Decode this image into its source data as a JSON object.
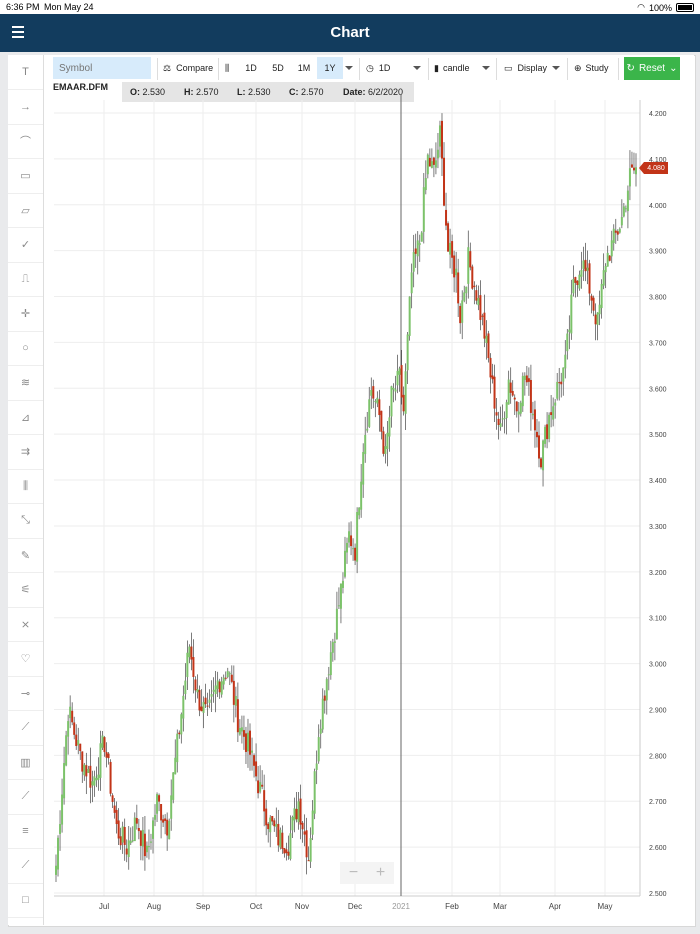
{
  "status": {
    "time": "6:36 PM",
    "date": "Mon May 24",
    "battery": "100%"
  },
  "header": {
    "title": "Chart",
    "menu_icon": "hamburger-icon"
  },
  "toolbar": {
    "symbol_placeholder": "Symbol",
    "compare": "Compare",
    "ranges": [
      "1D",
      "5D",
      "1M",
      "1Y"
    ],
    "active_range": "1Y",
    "interval": "1D",
    "chart_type": "candle",
    "display": "Display",
    "study": "Study",
    "reset": "Reset",
    "accent": "#3bb54a"
  },
  "drawing_tools": [
    "text-icon",
    "arrow-icon",
    "arc-icon",
    "callout-icon",
    "parallelogram-icon",
    "check-icon",
    "step-icon",
    "crosshair-icon",
    "ellipse-icon",
    "fan-icon",
    "gann-icon",
    "channel-icon",
    "pitchfork-icon",
    "scatter-icon",
    "note-icon",
    "speedline-icon",
    "xabcd-icon",
    "heart-icon",
    "horizontal-line-icon",
    "trendline-icon",
    "volume-profile-icon",
    "ruler-icon",
    "fibonacci-icon",
    "line-icon",
    "rectangle-icon"
  ],
  "info": {
    "symbol": "EMAAR.DFM",
    "open_label": "O:",
    "open": "2.530",
    "high_label": "H:",
    "high": "2.570",
    "low_label": "L:",
    "low": "2.530",
    "close_label": "C:",
    "close": "2.570",
    "date_label": "Date:",
    "date": "6/2/2020"
  },
  "last_price": "4.080",
  "colors": {
    "up": "#7cc26a",
    "down": "#c23418",
    "grid": "#eeeeee",
    "navbar": "#123c5e"
  },
  "chart_data": {
    "type": "candlestick",
    "symbol": "EMAAR.DFM",
    "y_ticks": [
      "2.500",
      "2.600",
      "2.700",
      "2.800",
      "2.900",
      "3.000",
      "3.100",
      "3.200",
      "3.300",
      "3.400",
      "3.500",
      "3.600",
      "3.700",
      "3.800",
      "3.900",
      "4.000",
      "4.100",
      "4.200"
    ],
    "ylim": [
      2.5,
      4.2
    ],
    "x_ticks": [
      "Jul",
      "Aug",
      "Sep",
      "Oct",
      "Nov",
      "Dec",
      "2021",
      "Feb",
      "Mar",
      "Apr",
      "May"
    ],
    "grid": true,
    "crosshair_at": "2021",
    "anchors": [
      [
        0,
        2.56
      ],
      [
        6,
        2.9
      ],
      [
        12,
        2.8
      ],
      [
        18,
        2.74
      ],
      [
        24,
        2.83
      ],
      [
        30,
        2.64
      ],
      [
        35,
        2.6
      ],
      [
        40,
        2.66
      ],
      [
        45,
        2.58
      ],
      [
        50,
        2.7
      ],
      [
        55,
        2.65
      ],
      [
        60,
        2.82
      ],
      [
        66,
        3.04
      ],
      [
        70,
        2.93
      ],
      [
        75,
        2.88
      ],
      [
        80,
        2.96
      ],
      [
        85,
        2.99
      ],
      [
        90,
        2.88
      ],
      [
        95,
        2.82
      ],
      [
        100,
        2.74
      ],
      [
        105,
        2.66
      ],
      [
        110,
        2.62
      ],
      [
        115,
        2.61
      ],
      [
        120,
        2.7
      ],
      [
        125,
        2.58
      ],
      [
        130,
        2.86
      ],
      [
        135,
        3.0
      ],
      [
        140,
        3.13
      ],
      [
        145,
        3.28
      ],
      [
        148,
        3.25
      ],
      [
        152,
        3.48
      ],
      [
        156,
        3.6
      ],
      [
        160,
        3.54
      ],
      [
        163,
        3.45
      ],
      [
        166,
        3.58
      ],
      [
        170,
        3.62
      ],
      [
        172,
        3.55
      ],
      [
        176,
        3.85
      ],
      [
        180,
        3.92
      ],
      [
        184,
        4.1
      ],
      [
        187,
        4.07
      ],
      [
        190,
        4.15
      ],
      [
        194,
        3.9
      ],
      [
        198,
        3.85
      ],
      [
        200,
        3.76
      ],
      [
        204,
        3.88
      ],
      [
        208,
        3.81
      ],
      [
        212,
        3.72
      ],
      [
        216,
        3.6
      ],
      [
        220,
        3.5
      ],
      [
        224,
        3.62
      ],
      [
        228,
        3.56
      ],
      [
        232,
        3.63
      ],
      [
        236,
        3.55
      ],
      [
        240,
        3.45
      ],
      [
        244,
        3.54
      ],
      [
        248,
        3.6
      ],
      [
        252,
        3.65
      ],
      [
        256,
        3.82
      ],
      [
        260,
        3.88
      ],
      [
        264,
        3.82
      ],
      [
        268,
        3.74
      ],
      [
        272,
        3.88
      ],
      [
        276,
        3.92
      ],
      [
        280,
        3.97
      ],
      [
        284,
        4.06
      ],
      [
        287,
        4.08
      ]
    ],
    "last": 4.08
  }
}
